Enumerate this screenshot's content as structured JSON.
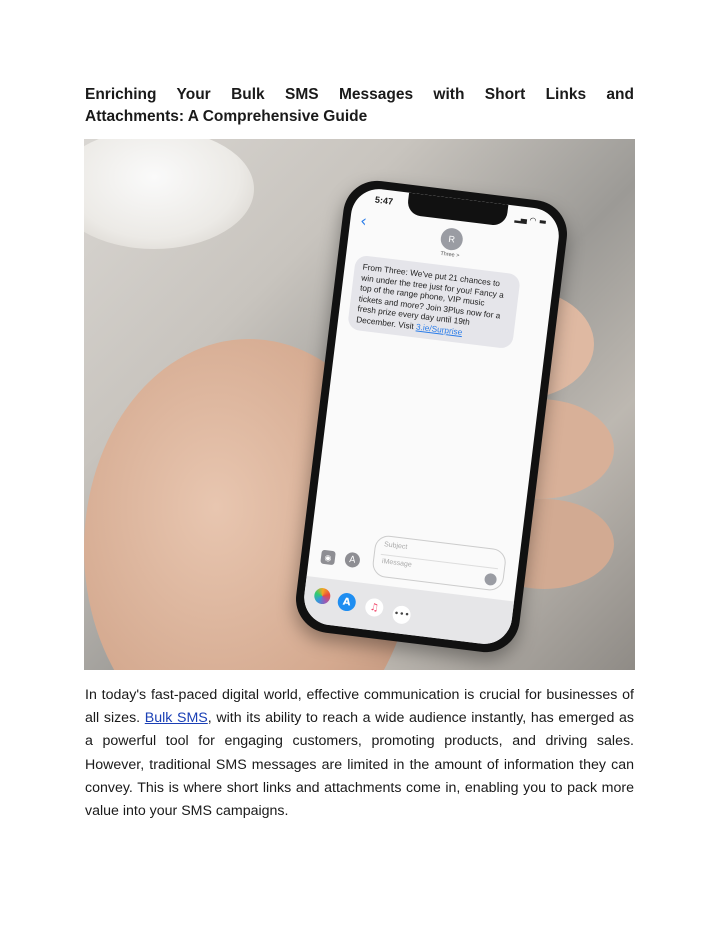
{
  "document": {
    "title_line1": "Enriching Your Bulk SMS Messages with Short Links and",
    "title_line2": "Attachments: A Comprehensive Guide",
    "paragraph": {
      "before_link": "In today's fast-paced digital world, effective communication is crucial for businesses of all sizes. ",
      "link_text": "Bulk SMS",
      "after_link": ", with its ability to reach a wide audience instantly, has emerged as a powerful tool for engaging customers, promoting products, and driving sales. However, traditional SMS messages are limited in the amount of information they can convey. This is where short links and attachments come in, enabling you to pack more value into your SMS campaigns."
    }
  },
  "photo": {
    "description": "Hand holding smartphone showing SMS message",
    "phone": {
      "time": "5:47",
      "status_icons": "signal wifi battery",
      "back_icon": "‹",
      "avatar_initial": "R",
      "contact_name": "Three >",
      "message_text": "From Three: We've put 21 chances to win under the tree just for you! Fancy a top of the range phone, VIP music tickets and more? Join 3Plus now for a fresh prize every day until 19th December. Visit ",
      "message_link": "3.ie/Surprise",
      "compose_subject_placeholder": "Subject",
      "compose_message_placeholder": "iMessage"
    }
  }
}
